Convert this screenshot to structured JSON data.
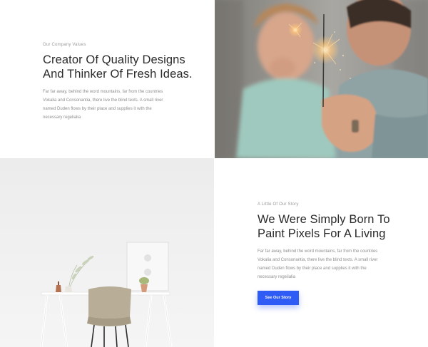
{
  "values_block": {
    "eyebrow": "Our Company Values",
    "heading_line1": "Creator Of Quality Designs",
    "heading_line2": "And Thinker Of Fresh Ideas.",
    "para_line1": "Far far away, behind the word mountains, far from the countries",
    "para_line2": "Vokalia and Consonantia, there live the blind texts. A small river",
    "para_line3": "named Duden flows by their place and supplies it with the",
    "para_line4": "necessary regelialia"
  },
  "story_block": {
    "eyebrow": "A Little Of Our Story",
    "heading_line1": "We Were Simply Born To",
    "heading_line2": "Paint Pixels For A Living",
    "para_line1": "Far far away, behind the word mountains, far from the countries",
    "para_line2": "Vokalia and Consonantia, there live the blind texts. A small river",
    "para_line3": "named Duden flows by their place and supplies it with the",
    "para_line4": "necessary regelialia",
    "button_label": "See Our Story"
  },
  "colors": {
    "accent": "#2f5cf5",
    "heading": "#2a2a2a",
    "muted": "#8e8e8e"
  },
  "images": {
    "top": "photo-father-child-sparkler",
    "bottom": "photo-minimal-desk-chair"
  }
}
